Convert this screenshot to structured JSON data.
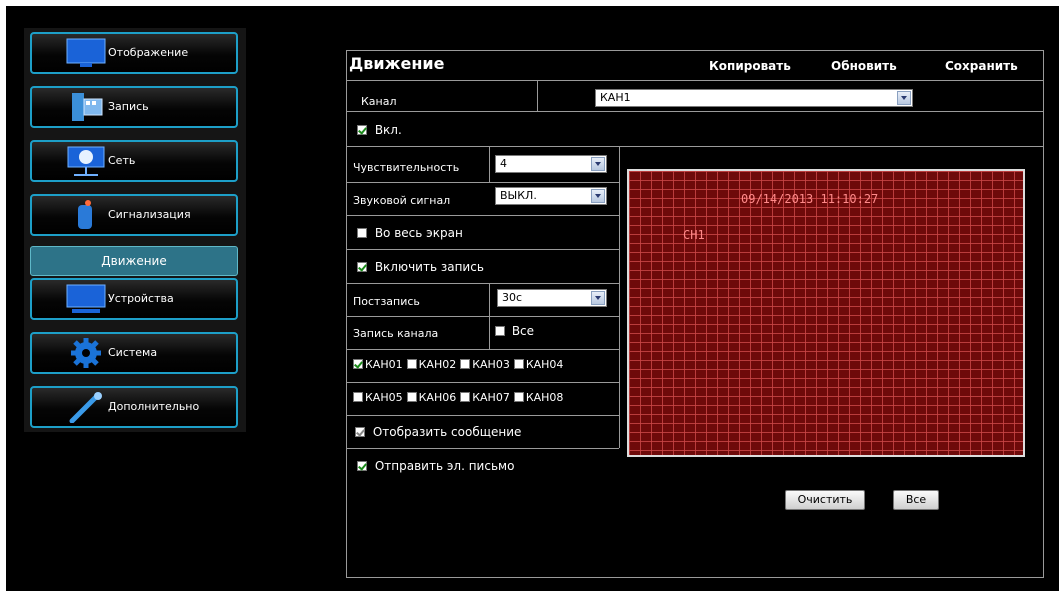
{
  "sidebar": {
    "items": [
      {
        "label": "Отображение",
        "icon": "monitor-icon"
      },
      {
        "label": "Запись",
        "icon": "film-icon"
      },
      {
        "label": "Сеть",
        "icon": "network-icon"
      },
      {
        "label": "Сигнализация",
        "icon": "alarm-icon"
      },
      {
        "label": "Движение",
        "icon": ""
      },
      {
        "label": "Устройства",
        "icon": "devices-icon"
      },
      {
        "label": "Система",
        "icon": "gear-icon"
      },
      {
        "label": "Дополнительно",
        "icon": "tools-icon"
      }
    ],
    "selected": "Движение"
  },
  "panel": {
    "title": "Движение",
    "toolbar": {
      "copy": "Копировать",
      "refresh": "Обновить",
      "save": "Сохранить"
    },
    "channel_label": "Канал",
    "channel_value": "КАН1",
    "enable_label": "Вкл.",
    "sensitivity_label": "Чувствительность",
    "sensitivity_value": "4",
    "buzzer_label": "Звуковой сигнал",
    "buzzer_value": "ВЫКЛ.",
    "fullscreen_label": "Во весь экран",
    "record_label": "Включить запись",
    "postrecord_label": "Постзапись",
    "postrecord_value": "30с",
    "record_channel_label": "Запись канала",
    "all_label": "Все",
    "channels": [
      "КАН01",
      "КАН02",
      "КАН03",
      "КАН04",
      "КАН05",
      "КАН06",
      "КАН07",
      "КАН08"
    ],
    "show_message_label": "Отобразить сообщение",
    "send_email_label": "Отправить эл. письмо",
    "preview": {
      "timestamp": "09/14/2013 11:10:27",
      "channel": "CH1"
    },
    "clear_button": "Очистить",
    "all_button": "Все"
  },
  "colors": {
    "accent": "#1d9fc8",
    "selected": "#2d7388",
    "grid": "#6e0a0a"
  }
}
